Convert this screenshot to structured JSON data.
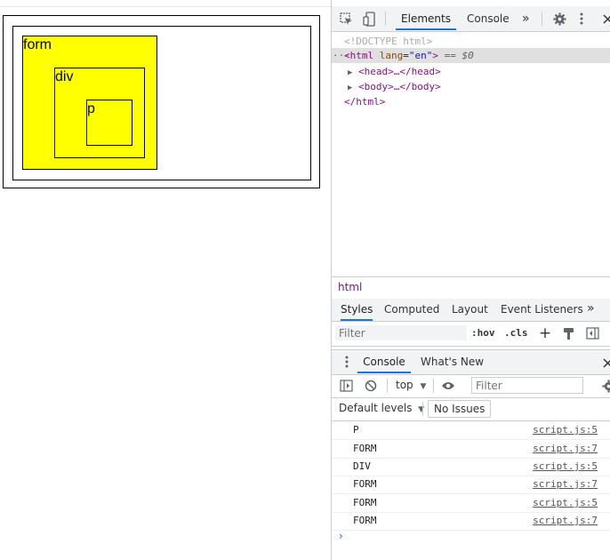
{
  "page": {
    "boxes": {
      "form_label": "form",
      "div_label": "div",
      "p_label": "p"
    },
    "form_color": "#ffff00"
  },
  "devtools": {
    "tabs": [
      "Elements",
      "Console"
    ],
    "more": "»",
    "dom": {
      "doctype": "<!DOCTYPE html>",
      "html_open_tag": "<html",
      "html_attr_name": "lang",
      "html_attr_value": "\"en\"",
      "html_open_end": ">",
      "selected_marker": "== $0",
      "head": "<head>…</head>",
      "body": "<body>…</body>",
      "html_close": "</html>",
      "ellipsis": "···"
    },
    "breadcrumb": "html",
    "subtabs": [
      "Styles",
      "Computed",
      "Layout",
      "Event Listeners"
    ],
    "styles_filter_placeholder": "Filter",
    "hov": ":hov",
    "cls": ".cls",
    "drawer_tabs": [
      "Console",
      "What's New"
    ],
    "context": "top",
    "console_filter_placeholder": "Filter",
    "default_levels": "Default levels",
    "no_issues": "No Issues",
    "logs": [
      {
        "msg": "P",
        "src": "script.js:5"
      },
      {
        "msg": "FORM",
        "src": "script.js:7"
      },
      {
        "msg": "DIV",
        "src": "script.js:5"
      },
      {
        "msg": "FORM",
        "src": "script.js:7"
      },
      {
        "msg": "FORM",
        "src": "script.js:5"
      },
      {
        "msg": "FORM",
        "src": "script.js:7"
      }
    ],
    "prompt": "›"
  }
}
